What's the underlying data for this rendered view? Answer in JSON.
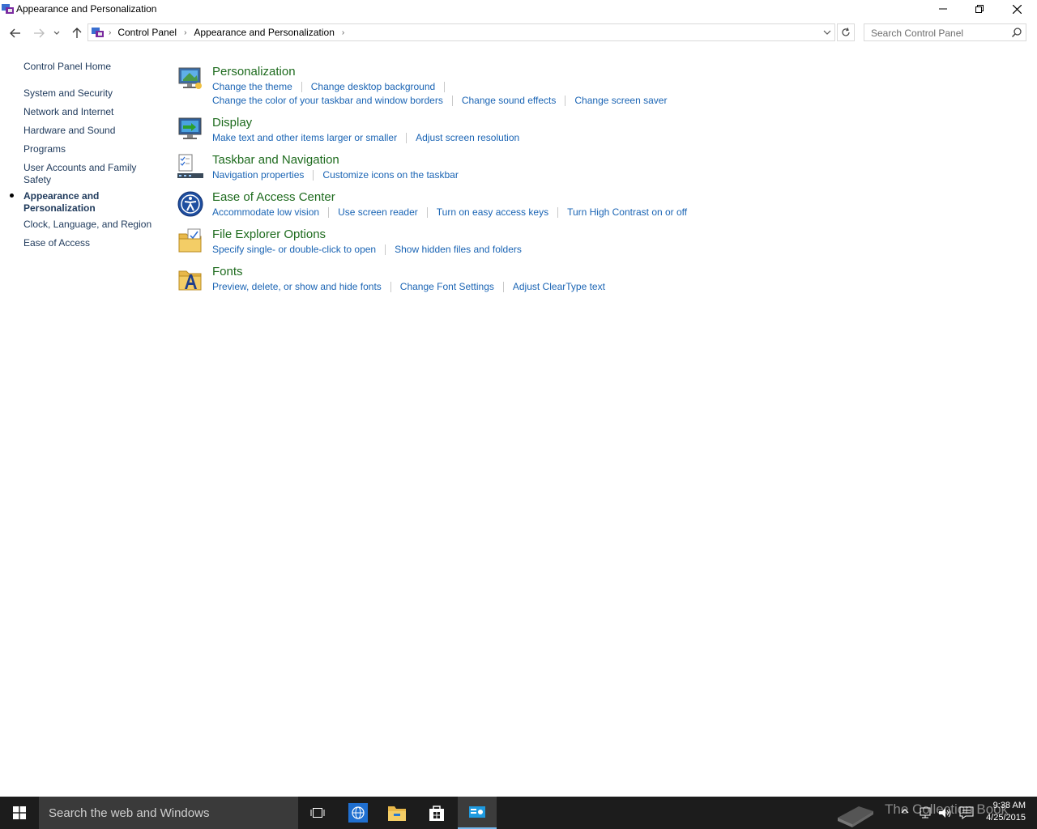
{
  "window": {
    "title": "Appearance and Personalization"
  },
  "address": {
    "crumbs": [
      "Control Panel",
      "Appearance and Personalization"
    ]
  },
  "search": {
    "placeholder": "Search Control Panel"
  },
  "leftnav": {
    "home": "Control Panel Home",
    "items": [
      "System and Security",
      "Network and Internet",
      "Hardware and Sound",
      "Programs",
      "User Accounts and Family Safety",
      "Appearance and Personalization",
      "Clock, Language, and Region",
      "Ease of Access"
    ]
  },
  "categories": [
    {
      "title": "Personalization",
      "icon": "personalization-icon",
      "links_row1": [
        "Change the theme",
        "Change desktop background"
      ],
      "links_row2": [
        "Change the color of your taskbar and window borders",
        "Change sound effects",
        "Change screen saver"
      ]
    },
    {
      "title": "Display",
      "icon": "display-icon",
      "links_row1": [
        "Make text and other items larger or smaller",
        "Adjust screen resolution"
      ]
    },
    {
      "title": "Taskbar and Navigation",
      "icon": "taskbar-icon",
      "links_row1": [
        "Navigation properties",
        "Customize icons on the taskbar"
      ]
    },
    {
      "title": "Ease of Access Center",
      "icon": "ease-of-access-icon",
      "links_row1": [
        "Accommodate low vision",
        "Use screen reader",
        "Turn on easy access keys",
        "Turn High Contrast on or off"
      ]
    },
    {
      "title": "File Explorer Options",
      "icon": "folder-options-icon",
      "links_row1": [
        "Specify single- or double-click to open",
        "Show hidden files and folders"
      ]
    },
    {
      "title": "Fonts",
      "icon": "fonts-icon",
      "links_row1": [
        "Preview, delete, or show and hide fonts",
        "Change Font Settings",
        "Adjust ClearType text"
      ]
    }
  ],
  "taskbar": {
    "search_text": "Search the web and Windows",
    "time": "9:38 AM",
    "date": "4/25/2015",
    "watermark": "The Collection Book"
  },
  "colors": {
    "link": "#1a64b4",
    "category_title": "#1e6b1e",
    "taskbar": "#1c1c1c"
  }
}
